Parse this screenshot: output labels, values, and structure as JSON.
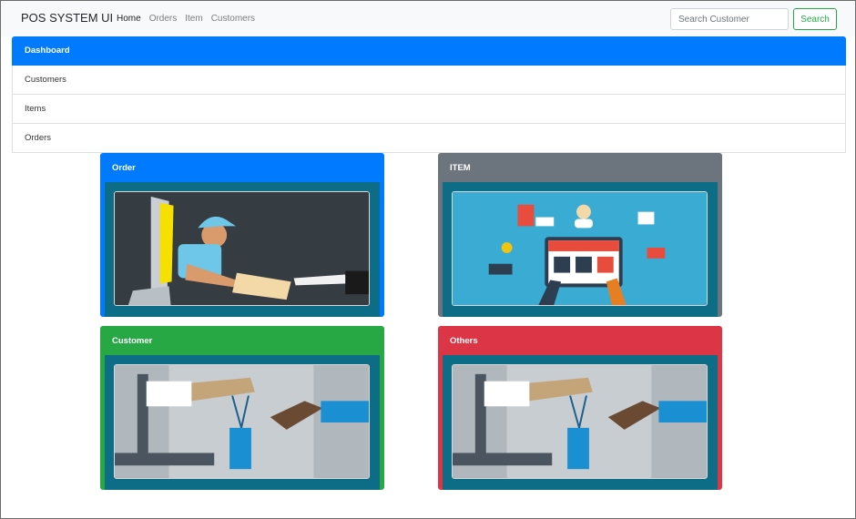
{
  "navbar": {
    "brand": "POS SYSTEM UI",
    "links": [
      "Home",
      "Orders",
      "Item",
      "Customers"
    ],
    "search_placeholder": "Search Customer",
    "search_button": "Search"
  },
  "menu": {
    "items": [
      "Dashboard",
      "Customers",
      "Items",
      "Orders"
    ]
  },
  "cards": [
    {
      "title": "Order",
      "image": "delivery-person-illustration",
      "color": "#007bff"
    },
    {
      "title": "ITEM",
      "image": "online-shop-illustration",
      "color": "#6c757d"
    },
    {
      "title": "Customer",
      "image": "shopping-bag-handover-illustration",
      "color": "#28a745"
    },
    {
      "title": "Others",
      "image": "shopping-bag-handover-illustration",
      "color": "#dc3545"
    }
  ]
}
